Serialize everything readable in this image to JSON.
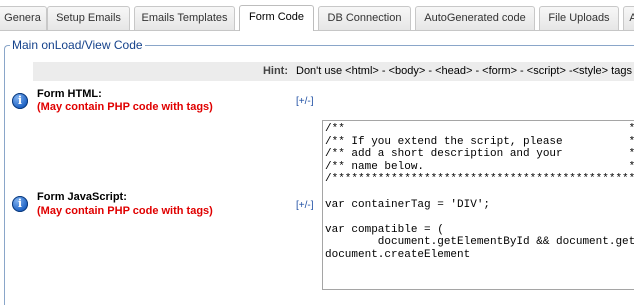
{
  "tabs": [
    {
      "label": "Genera",
      "active": false
    },
    {
      "label": "Setup Emails",
      "active": false
    },
    {
      "label": "Emails Templates",
      "active": false
    },
    {
      "label": "Form Code",
      "active": true
    },
    {
      "label": "DB Connection",
      "active": false
    },
    {
      "label": "AutoGenerated code",
      "active": false
    },
    {
      "label": "File Uploads",
      "active": false
    },
    {
      "label": "A",
      "active": false
    }
  ],
  "section": {
    "title": "Main onLoad/View Code"
  },
  "hint": {
    "label": "Hint:",
    "text": "Don't use <html> - <body> - <head> - <form> - <script> -<style> tags in"
  },
  "fields": {
    "form_html": {
      "label": "Form HTML:",
      "note": "(May contain PHP code with tags)",
      "toggle": "[+/-]"
    },
    "form_javascript": {
      "label": "Form JavaScript:",
      "note": "(May contain PHP code with tags)",
      "toggle": "[+/-]",
      "code_lines": [
        "/**                                           **/",
        "/** If you extend the script, please          **/",
        "/** add a short description and your          **/",
        "/** name below.                               **/",
        "/***********************************************/",
        "",
        "var containerTag = 'DIV';",
        "",
        "var compatible = (",
        "        document.getElementById && document.getElementsByTagName &&",
        "document.createElement"
      ]
    }
  }
}
